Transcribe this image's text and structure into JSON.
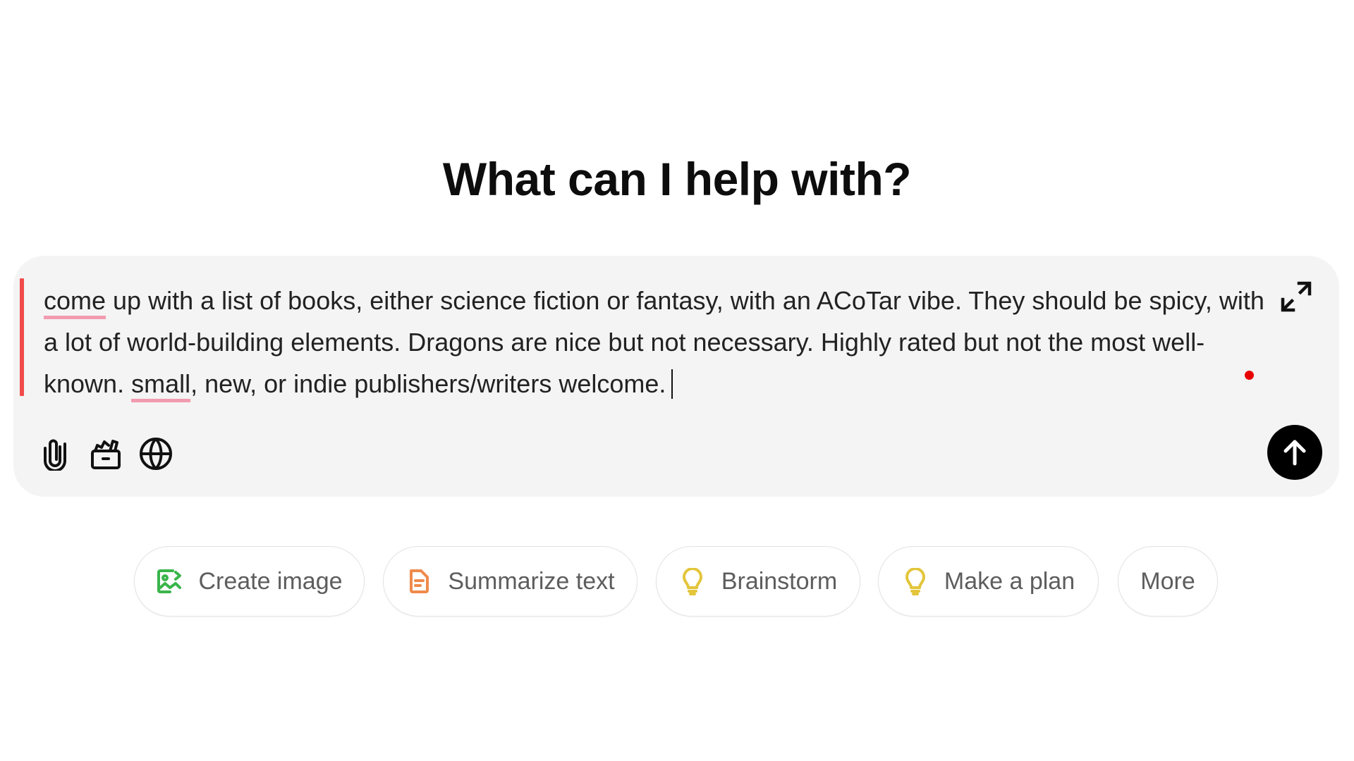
{
  "heading": "What can I help with?",
  "composer": {
    "text_segments": [
      {
        "text": "come",
        "misspelled": true
      },
      {
        "text": " up with a list of books, either science fiction or fantasy, with an ACoTar vibe. They should be spicy, with a lot of world-building elements. Dragons are nice but not necessary. Highly rated but not the most well-known. ",
        "misspelled": false
      },
      {
        "text": "small",
        "misspelled": true
      },
      {
        "text": ", new, or indie publishers/writers welcome.",
        "misspelled": false
      }
    ],
    "icons": {
      "expand": "expand-icon",
      "attach": "paperclip-icon",
      "tools": "toolbox-icon",
      "search": "globe-icon",
      "send": "arrow-up-icon"
    },
    "recording_indicator_color": "#e80000",
    "focus_bar_color": "#f24b4b"
  },
  "suggestions": [
    {
      "label": "Create image",
      "icon": "image-icon",
      "color": "#3ab54a"
    },
    {
      "label": "Summarize text",
      "icon": "document-icon",
      "color": "#ef8a4c"
    },
    {
      "label": "Brainstorm",
      "icon": "lightbulb-icon",
      "color": "#e3c53a"
    },
    {
      "label": "Make a plan",
      "icon": "lightbulb-icon",
      "color": "#e3c53a"
    },
    {
      "label": "More",
      "icon": null,
      "color": null
    }
  ]
}
